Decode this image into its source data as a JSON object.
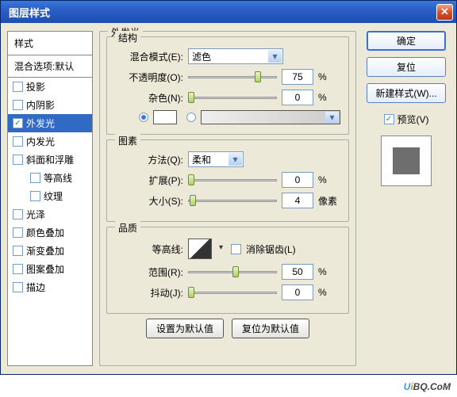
{
  "window": {
    "title": "图层样式"
  },
  "sidebar": {
    "header": "样式",
    "blend_options": "混合选项:默认",
    "items": [
      {
        "key": "drop-shadow",
        "label": "投影",
        "checked": false
      },
      {
        "key": "inner-shadow",
        "label": "内阴影",
        "checked": false
      },
      {
        "key": "outer-glow",
        "label": "外发光",
        "checked": true,
        "selected": true
      },
      {
        "key": "inner-glow",
        "label": "内发光",
        "checked": false
      },
      {
        "key": "bevel-emboss",
        "label": "斜面和浮雕",
        "checked": false
      },
      {
        "key": "contour",
        "label": "等高线",
        "checked": false,
        "indent": true
      },
      {
        "key": "texture",
        "label": "纹理",
        "checked": false,
        "indent": true
      },
      {
        "key": "satin",
        "label": "光泽",
        "checked": false
      },
      {
        "key": "color-overlay",
        "label": "颜色叠加",
        "checked": false
      },
      {
        "key": "gradient-overlay",
        "label": "渐变叠加",
        "checked": false
      },
      {
        "key": "pattern-overlay",
        "label": "图案叠加",
        "checked": false
      },
      {
        "key": "stroke",
        "label": "描边",
        "checked": false
      }
    ]
  },
  "panel": {
    "title": "外发光",
    "structure": {
      "legend": "结构",
      "blend_mode_label": "混合模式(E):",
      "blend_mode_value": "滤色",
      "opacity_label": "不透明度(O):",
      "opacity_value": "75",
      "opacity_unit": "%",
      "noise_label": "杂色(N):",
      "noise_value": "0",
      "noise_unit": "%"
    },
    "elements": {
      "legend": "图素",
      "technique_label": "方法(Q):",
      "technique_value": "柔和",
      "spread_label": "扩展(P):",
      "spread_value": "0",
      "spread_unit": "%",
      "size_label": "大小(S):",
      "size_value": "4",
      "size_unit": "像素"
    },
    "quality": {
      "legend": "品质",
      "contour_label": "等高线:",
      "antialias_label": "消除锯齿(L)",
      "range_label": "范围(R):",
      "range_value": "50",
      "range_unit": "%",
      "jitter_label": "抖动(J):",
      "jitter_value": "0",
      "jitter_unit": "%"
    },
    "buttons": {
      "make_default": "设置为默认值",
      "reset_default": "复位为默认值"
    }
  },
  "right": {
    "ok": "确定",
    "cancel": "复位",
    "new_style": "新建样式(W)...",
    "preview": "预览(V)"
  },
  "watermark": {
    "u": "U",
    "i": "i",
    "rest": "BQ.CoM"
  }
}
